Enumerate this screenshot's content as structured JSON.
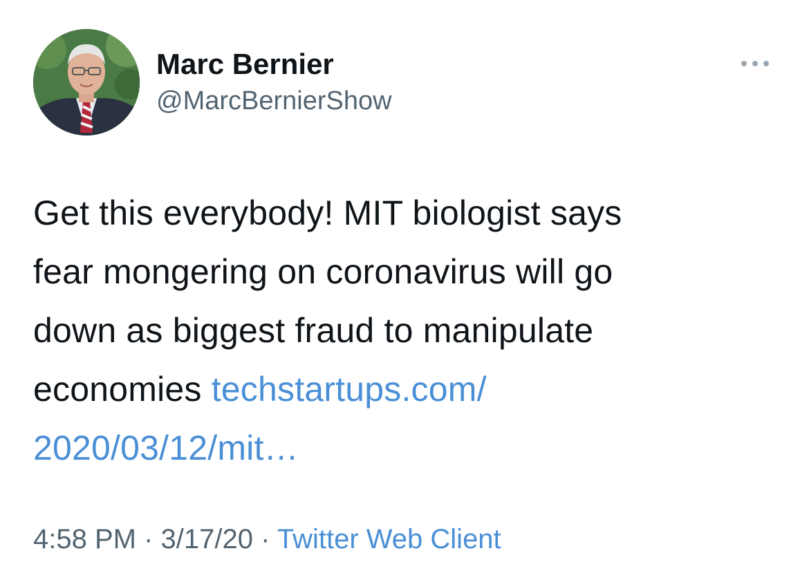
{
  "tweet": {
    "author": {
      "display_name": "Marc Bernier",
      "handle": "@MarcBernierShow"
    },
    "text_line_1": "Get this everybody! MIT biologist says",
    "text_line_2": "fear mongering on coronavirus will go",
    "text_line_3": "down as biggest fraud to manipulate",
    "text_line_4_prefix": "economies",
    "link_line_1": "techstartups.com/",
    "link_line_2": "2020/03/12/mit…",
    "time": "4:58 PM",
    "separator": "·",
    "date": "3/17/20",
    "source": "Twitter Web Client"
  },
  "icons": {
    "more": "more-horizontal-icon",
    "avatar": "profile-photo"
  },
  "colors": {
    "link": "#4a8fd6",
    "text": "#0f1419",
    "secondary": "#536471"
  }
}
